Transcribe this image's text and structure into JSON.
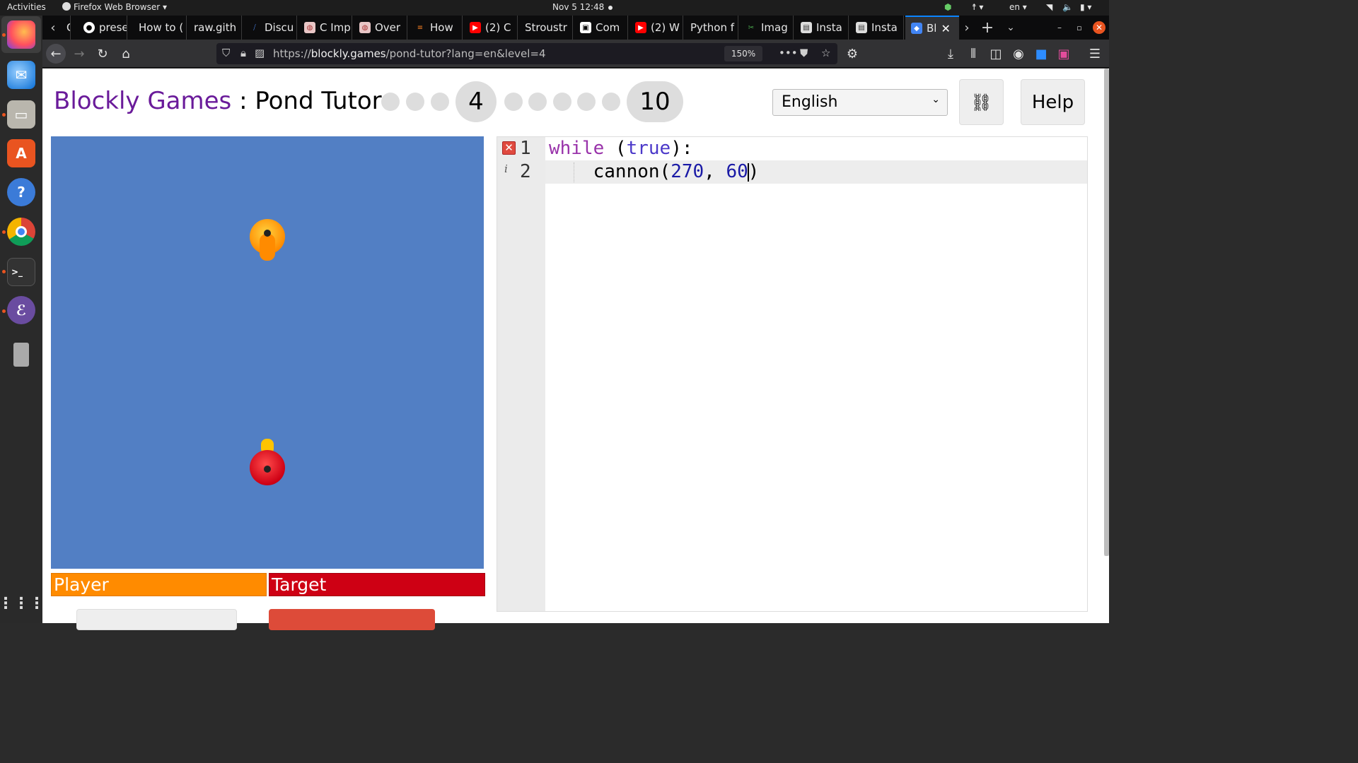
{
  "system": {
    "activities": "Activities",
    "app_menu": "Firefox Web Browser ▾",
    "clock": "Nov 5  12:48",
    "lang": "en ▾"
  },
  "tabs": [
    {
      "label": "O",
      "icon": "page-icon"
    },
    {
      "label": "prese",
      "icon": "github-icon"
    },
    {
      "label": "How to (",
      "icon": "none"
    },
    {
      "label": "raw.gith",
      "icon": "none"
    },
    {
      "label": "Discu",
      "icon": "discuss-icon"
    },
    {
      "label": "C Imp",
      "icon": "cplusplus-icon"
    },
    {
      "label": "Over",
      "icon": "cplusplus-icon"
    },
    {
      "label": "How",
      "icon": "stackoverflow-icon"
    },
    {
      "label": "(2) C",
      "icon": "youtube-icon"
    },
    {
      "label": "Stroustr",
      "icon": "none"
    },
    {
      "label": "Com",
      "icon": "page-icon"
    },
    {
      "label": "(2) W",
      "icon": "youtube-icon"
    },
    {
      "label": "Python f",
      "icon": "none"
    },
    {
      "label": "Imag",
      "icon": "scissors-icon"
    },
    {
      "label": "Insta",
      "icon": "doc-icon"
    },
    {
      "label": "Insta",
      "icon": "doc-icon"
    },
    {
      "label": "Bl",
      "icon": "blockly-icon"
    }
  ],
  "navbar": {
    "url_prefix": "https://",
    "url_domain": "blockly.games",
    "url_path": "/pond-tutor?lang=en&level=4",
    "zoom": "150%"
  },
  "game": {
    "brand": "Blockly Games",
    "separator": " : ",
    "title": "Pond Tutor",
    "current_level": "4",
    "max_level": "10",
    "language": "English",
    "help": "Help",
    "player_label": "Player",
    "target_label": "Target",
    "player_color": "#ff8b00",
    "target_color": "#ce0014",
    "pond_color": "#527fc4"
  },
  "editor": {
    "line1_num": "1",
    "line2_num": "2",
    "line1_kw": "while",
    "line1_open": " (",
    "line1_bool": "true",
    "line1_close": "):",
    "line2_fn": "    cannon(",
    "line2_arg1": "270",
    "line2_comma": ", ",
    "line2_arg2": "60",
    "line2_close": ")"
  }
}
